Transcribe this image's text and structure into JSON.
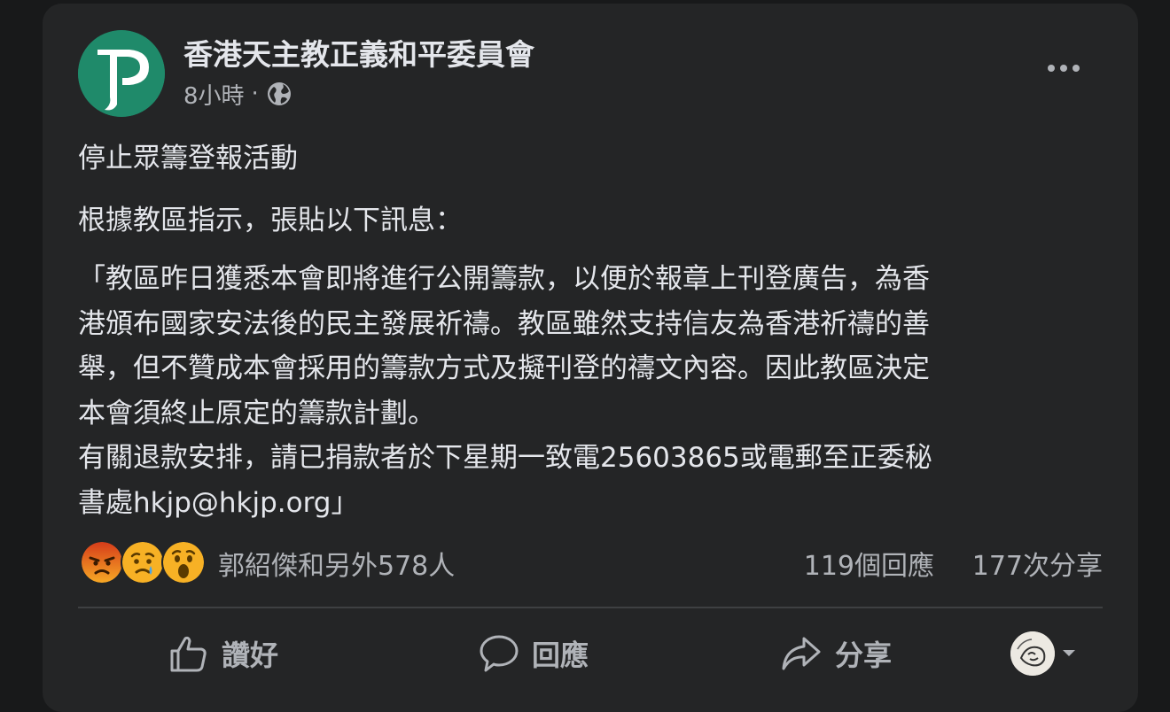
{
  "post": {
    "page_name": "香港天主教正義和平委員會",
    "timestamp": "8小時",
    "separator": "·",
    "audience_icon": "globe-icon",
    "more_icon": "more-options-icon",
    "text_lines": [
      "停止眾籌登報活動",
      "根據教區指示，張貼以下訊息："
    ],
    "quote_lines": [
      "「教區昨日獲悉本會即將進行公開籌款，以便於報章上刊登廣告，為香",
      "港頒布國家安法後的民主發展祈禱。教區雖然支持信友為香港祈禱的善",
      "舉，但不贊成本會採用的籌款方式及擬刊登的禱文內容。因此教區決定",
      "本會須終止原定的籌款計劃￼￼。",
      "有關退款安排，請已捐款者於下星期一致電25603865或電郵至正委秘",
      "書處hkjp@hkjp.org」"
    ]
  },
  "engagement": {
    "reaction_icons": [
      "angry-reaction-icon",
      "sad-reaction-icon",
      "wow-reaction-icon"
    ],
    "reaction_summary": "郭紹傑和另外578人",
    "comments": "119個回應",
    "shares": "177次分享"
  },
  "actions": {
    "like_label": "讚好",
    "comment_label": "回應",
    "share_label": "分享"
  },
  "colors": {
    "background": "#18191a",
    "card": "#242526",
    "primary_text": "#e4e6eb",
    "secondary_text": "#b0b3b8",
    "brand_green": "#1f8a6a",
    "angry": "#e9710f",
    "reaction_yellow": "#f7b125"
  }
}
